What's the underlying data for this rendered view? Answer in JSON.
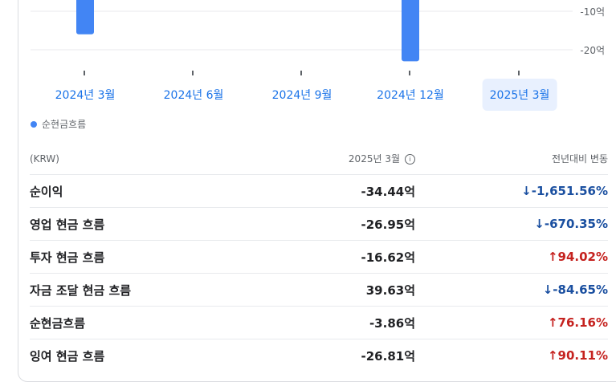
{
  "chart_data": {
    "type": "bar",
    "categories": [
      "2024년 3월",
      "2024년 6월",
      "2024년 9월",
      "2024년 12월",
      "2025년 3월"
    ],
    "series": [
      {
        "name": "순현금흐름",
        "values": [
          -16,
          null,
          null,
          -23,
          null
        ]
      }
    ],
    "y_ticks": [
      "-10억",
      "-20억"
    ],
    "selected_category": "2025년 3월",
    "color": "#4285f4"
  },
  "legend": {
    "label": "순현금흐름"
  },
  "table": {
    "header": {
      "col1": "(KRW)",
      "col2": "2025년 3월",
      "col3": "전년대비 변동"
    },
    "rows": [
      {
        "name": "순이익",
        "value": "-34.44억",
        "change": "↓-1,651.56%",
        "dir": "down"
      },
      {
        "name": "영업 현금 흐름",
        "value": "-26.95억",
        "change": "↓-670.35%",
        "dir": "down"
      },
      {
        "name": "투자 현금 흐름",
        "value": "-16.62억",
        "change": "↑94.02%",
        "dir": "up"
      },
      {
        "name": "자금 조달 현금 흐름",
        "value": "39.63억",
        "change": "↓-84.65%",
        "dir": "down"
      },
      {
        "name": "순현금흐름",
        "value": "-3.86억",
        "change": "↑76.16%",
        "dir": "up"
      },
      {
        "name": "잉여 현금 흐름",
        "value": "-26.81억",
        "change": "↑90.11%",
        "dir": "up"
      }
    ]
  }
}
